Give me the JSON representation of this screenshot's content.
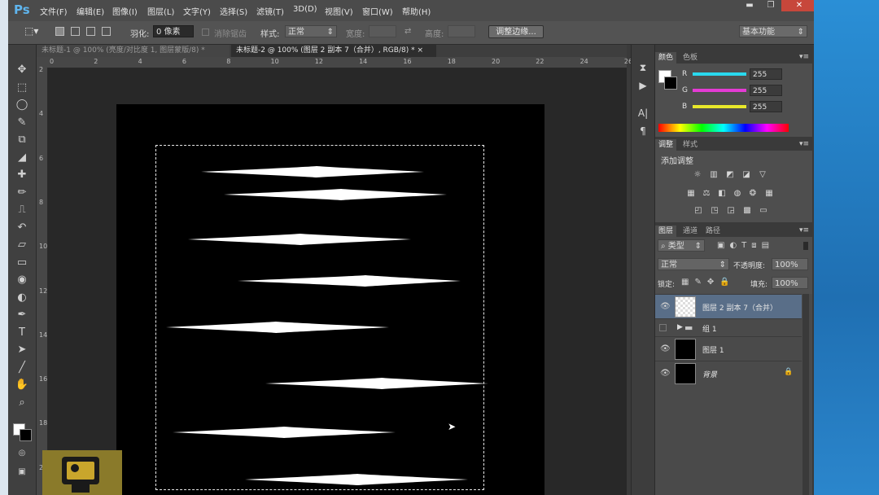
{
  "app": {
    "logo": "Ps",
    "menus": [
      "文件(F)",
      "编辑(E)",
      "图像(I)",
      "图层(L)",
      "文字(Y)",
      "选择(S)",
      "滤镜(T)",
      "3D(D)",
      "视图(V)",
      "窗口(W)",
      "帮助(H)"
    ],
    "window_buttons": {
      "minimize": "▬",
      "maximize": "❐",
      "close": "✕"
    }
  },
  "options": {
    "feather_label": "羽化:",
    "feather_value": "0 像素",
    "antialias_label": "消除锯齿",
    "style_label": "样式:",
    "style_value": "正常",
    "width_label": "宽度:",
    "height_label": "高度:",
    "refine_edge": "调整边缘...",
    "workspace": "基本功能"
  },
  "tabs": [
    {
      "label": "未标题-1 @ 100% (亮度/对比度 1, 图层蒙版/8) *",
      "close": "×"
    },
    {
      "label": "未标题-2 @ 100% (图层 2 副本 7（合并）, RGB/8) *",
      "close": "×"
    }
  ],
  "ruler": {
    "h_ticks": [
      "0",
      "2",
      "4",
      "6",
      "8",
      "10",
      "12",
      "14",
      "16",
      "18",
      "20",
      "22",
      "24",
      "26"
    ],
    "v_ticks": [
      "2",
      "4",
      "6",
      "8",
      "10",
      "12",
      "14",
      "16",
      "18",
      "20"
    ]
  },
  "tools": [
    "move-icon",
    "marquee-icon",
    "lasso-icon",
    "quick-select-icon",
    "crop-icon",
    "eyedropper-icon",
    "healing-icon",
    "brush-icon",
    "stamp-icon",
    "history-brush-icon",
    "eraser-icon",
    "gradient-icon",
    "blur-icon",
    "dodge-icon",
    "pen-icon",
    "type-icon",
    "path-select-icon",
    "line-icon",
    "hand-icon",
    "zoom-icon"
  ],
  "tool_glyphs": [
    "✥",
    "⬚",
    "◯",
    "✎",
    "⧉",
    "◢",
    "✚",
    "✏",
    "⎍",
    "↶",
    "▱",
    "▭",
    "◉",
    "◐",
    "✒",
    "T",
    "➤",
    "╱",
    "✋",
    "⌕"
  ],
  "color_panel": {
    "tabs": [
      "颜色",
      "色板"
    ],
    "channels": [
      {
        "name": "R",
        "value": "255",
        "color": "#29d9ee"
      },
      {
        "name": "G",
        "value": "255",
        "color": "#e43bd4"
      },
      {
        "name": "B",
        "value": "255",
        "color": "#e8e82a"
      }
    ]
  },
  "adjust_panel": {
    "tabs": [
      "调整",
      "样式"
    ],
    "title": "添加调整"
  },
  "layers_panel": {
    "tabs": [
      "图层",
      "通道",
      "路径"
    ],
    "filter": "类型",
    "blend_mode": "正常",
    "opacity_label": "不透明度:",
    "opacity_value": "100%",
    "lock_label": "锁定:",
    "fill_label": "填充:",
    "fill_value": "100%",
    "layers": [
      {
        "name": "图层 2 副本 7（合并）",
        "visible": true,
        "selected": true
      },
      {
        "name": "组 1",
        "visible": false,
        "selected": false
      },
      {
        "name": "图层 1",
        "visible": true,
        "selected": false
      },
      {
        "name": "背景",
        "visible": true,
        "selected": false
      }
    ]
  },
  "colors": {
    "accent": "#5fb5ee",
    "selected_layer": "#596e88"
  }
}
